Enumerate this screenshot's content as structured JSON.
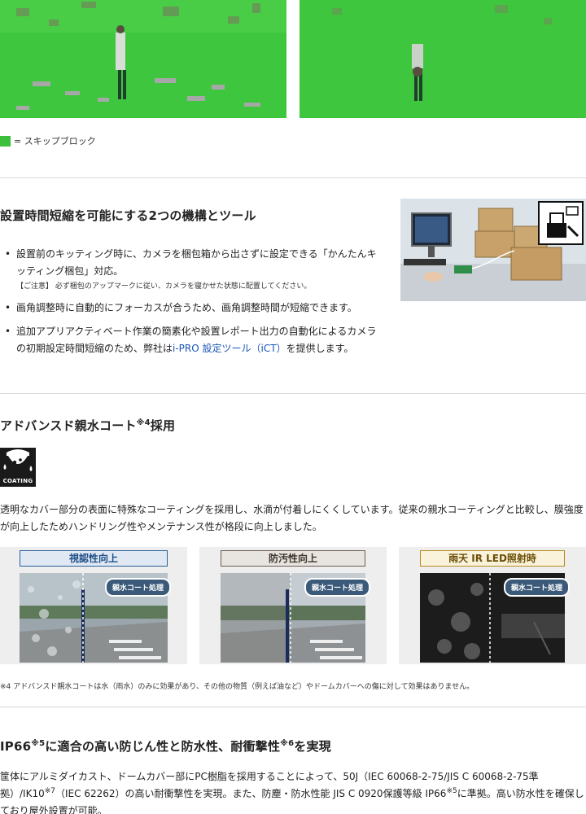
{
  "legend": {
    "text": "= スキップブロック",
    "color": "#3cc03c"
  },
  "section1": {
    "title": "設置時間短縮を可能にする2つの機構とツール",
    "bullets": [
      {
        "text": "設置前のキッティング時に、カメラを梱包箱から出さずに設定できる「かんたんキッティング梱包」対応。",
        "note": "【ご注意】 必ず梱包のアップマークに従い、カメラを寝かせた状態に配置してください。"
      },
      {
        "text": "画角調整時に自動的にフォーカスが合うため、画角調整時間が短縮できます。"
      },
      {
        "text_before": "追加アプリアクティベート作業の簡素化や設置レポート出力の自動化によるカメラの初期設定時間短縮のため、弊社は",
        "link": "i-PRO 設定ツール（iCT）",
        "text_after": "を提供します。"
      }
    ]
  },
  "section2": {
    "title": "アドバンスド親水コート",
    "title_sup": "※4",
    "title_suffix": "採用",
    "icon_label": "COATING",
    "body": "透明なカバー部分の表面に特殊なコーティングを採用し、水滴が付着しにくくしています。従来の親水コーティングと比較し、膜強度が向上したためハンドリング性やメンテナンス性が格段に向上しました。",
    "cards": [
      {
        "caption": "視認性向上",
        "tag": "親水コート処理",
        "cap_bg": "#dfe8f3",
        "cap_border": "#2a5f99",
        "cap_color": "#1f4f86"
      },
      {
        "caption": "防汚性向上",
        "tag": "親水コート処理",
        "cap_bg": "#e8e4df",
        "cap_border": "#6b5d52",
        "cap_color": "#3e342c"
      },
      {
        "caption": "雨天 IR LED照射時",
        "tag": "親水コート処理",
        "cap_bg": "#faf3dc",
        "cap_border": "#b48a1e",
        "cap_color": "#6b4e05"
      }
    ],
    "footnote": "※4 アドバンスド親水コートは水（雨水）のみに効果があり、その他の物質（例えば油など）やドームカバーへの傷に対して効果はありません。"
  },
  "section3": {
    "title_a": "IP66",
    "sup_a": "※5",
    "title_b": "に適合の高い防じん性と防水性、耐衝撃性",
    "sup_b": "※6",
    "title_c": "を実現",
    "body_a": "筐体にアルミダイカスト、ドームカバー部にPC樹脂を採用することによって、50J（IEC 60068-2-75/JIS C 60068-2-75準拠）/IK10",
    "sup_c": "※7",
    "body_b": "（IEC 62262）の高い耐衝撃性を実現。また、防塵・防水性能 JIS C 0920保護等級 IP66",
    "sup_d": "※5",
    "body_c": "に準拠。高い防水性を確保しており屋外設置が可能。"
  }
}
